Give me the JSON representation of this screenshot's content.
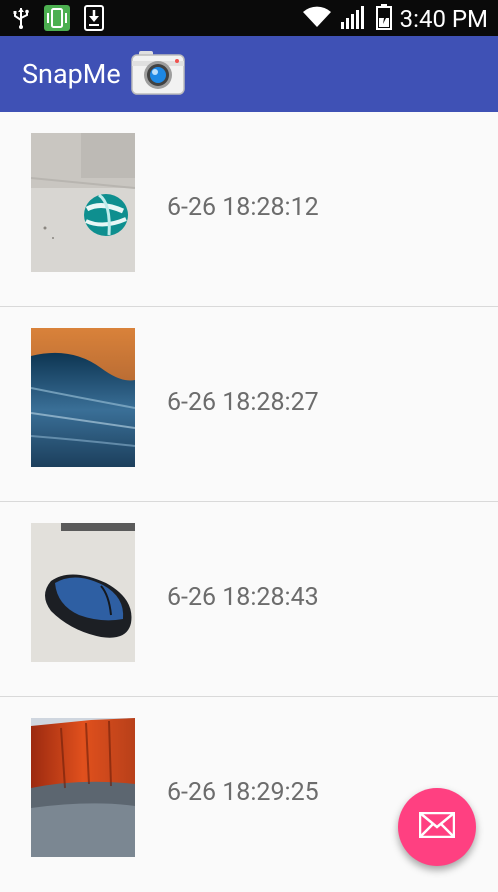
{
  "status_bar": {
    "time": "3:40 PM",
    "icons": [
      "usb-icon",
      "vibrate-icon",
      "download-icon",
      "wifi-icon",
      "signal-icon",
      "battery-charging-icon"
    ]
  },
  "app_bar": {
    "title": "SnapMe",
    "icon": "camera-icon",
    "color": "#3f51b5"
  },
  "snaps": [
    {
      "timestamp": "6-26 18:28:12",
      "thumbnail": "ball-on-desk-photo"
    },
    {
      "timestamp": "6-26 18:28:27",
      "thumbnail": "ocean-wave-photo"
    },
    {
      "timestamp": "6-26 18:28:43",
      "thumbnail": "computer-mouse-photo"
    },
    {
      "timestamp": "6-26 18:29:25",
      "thumbnail": "mountain-cliff-photo"
    }
  ],
  "fab": {
    "icon": "mail-icon",
    "color": "#ff4081"
  }
}
